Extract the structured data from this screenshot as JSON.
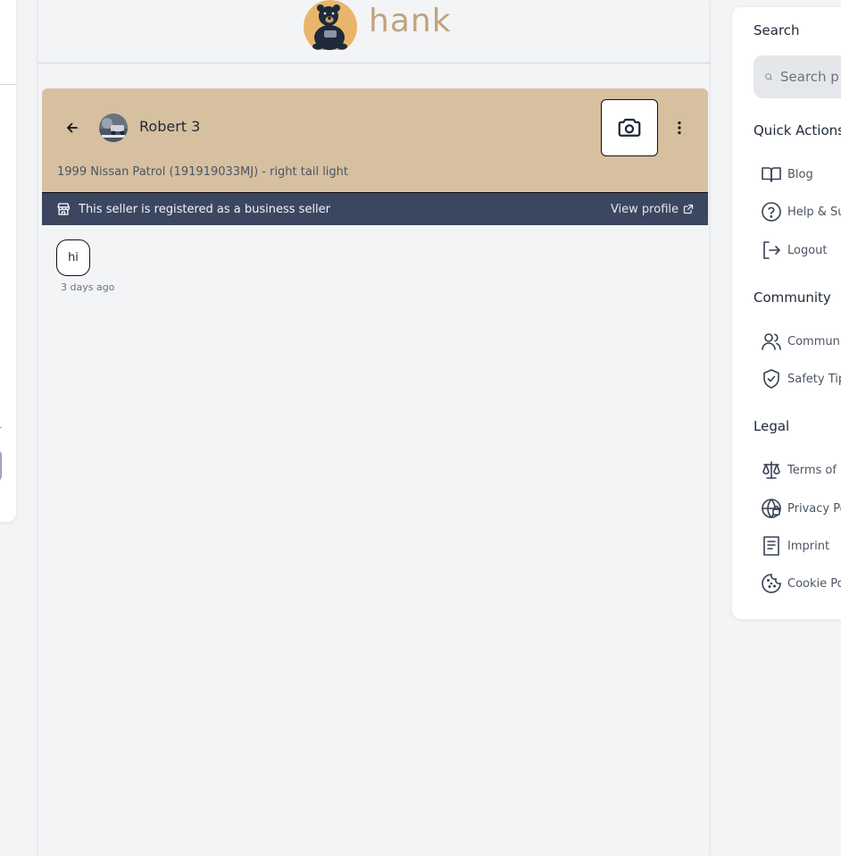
{
  "brand": {
    "name": "hank"
  },
  "chat": {
    "contact_name": "Robert 3",
    "listing_title": "1999 Nissan Patrol (191919033MJ) - right tail light",
    "business_notice": "This seller is registered as a business seller",
    "view_profile_label": "View profile",
    "messages": [
      {
        "text": "hi",
        "time": "3 days ago"
      }
    ]
  },
  "sidebar": {
    "search_heading": "Search",
    "search_placeholder": "Search p",
    "quick_actions_heading": "Quick Actions",
    "quick_actions": [
      {
        "label": "Blog",
        "icon": "book-icon"
      },
      {
        "label": "Help & Su",
        "icon": "help-circle-icon"
      },
      {
        "label": "Logout",
        "icon": "logout-icon"
      }
    ],
    "community_heading": "Community",
    "community": [
      {
        "label": "Communit",
        "icon": "users-icon"
      },
      {
        "label": "Safety Tip",
        "icon": "shield-check-icon"
      }
    ],
    "legal_heading": "Legal",
    "legal": [
      {
        "label": "Terms of S",
        "icon": "scale-icon"
      },
      {
        "label": "Privacy Po",
        "icon": "globe-lock-icon"
      },
      {
        "label": "Imprint",
        "icon": "receipt-icon"
      },
      {
        "label": "Cookie Po",
        "icon": "cookie-icon"
      }
    ]
  },
  "colors": {
    "chat_header_bg": "#d6c0a0",
    "business_bar_bg": "#3b4761",
    "brand_text": "#c2a27d",
    "page_bg": "#f3f4f6"
  }
}
